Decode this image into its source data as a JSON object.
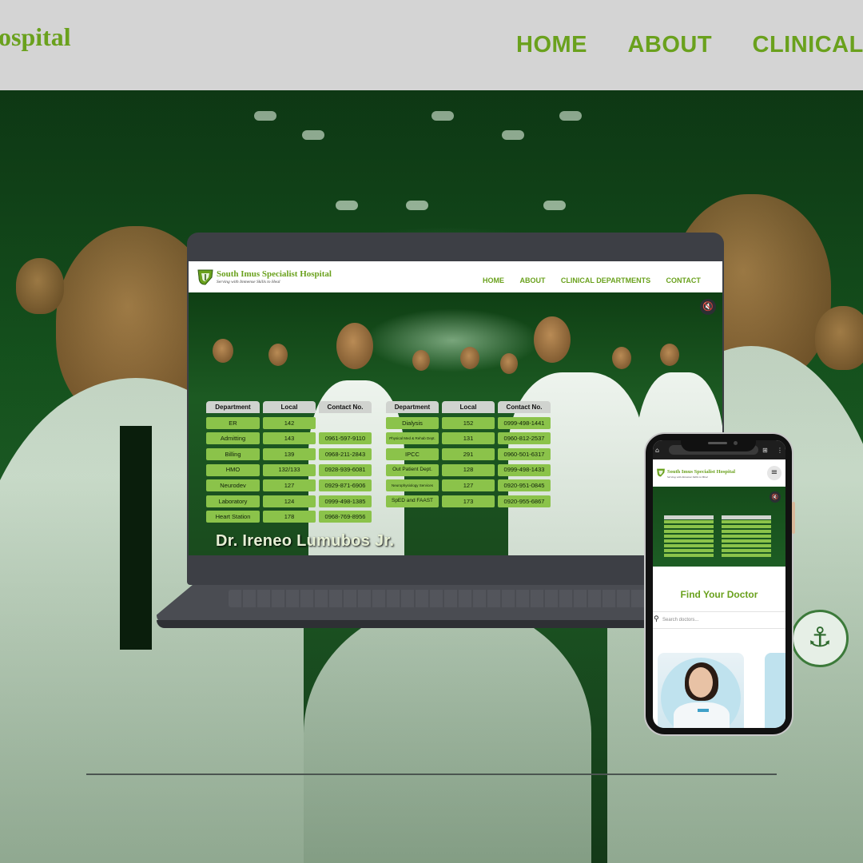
{
  "site": {
    "brand_cropped": "ospital",
    "nav": [
      "HOME",
      "ABOUT",
      "CLINICAL D"
    ],
    "name": "South Imus Specialist Hospital",
    "tagline": "Serving with Immense Skills to Heal",
    "laptop_nav": [
      "HOME",
      "ABOUT",
      "CLINICAL DEPARTMENTS",
      "CONTACT"
    ]
  },
  "hero": {
    "caption": "Dr. Ireneo Lumubos Jr.",
    "mute_icon": "mute-icon"
  },
  "directory": {
    "headers": [
      "Department",
      "Local",
      "Contact No."
    ],
    "left": [
      {
        "dept": "ER",
        "local": "142",
        "contact": ""
      },
      {
        "dept": "Admitting",
        "local": "143",
        "contact": "0961-597-9110"
      },
      {
        "dept": "Billing",
        "local": "139",
        "contact": "0968-211-2843"
      },
      {
        "dept": "HMO",
        "local": "132/133",
        "contact": "0928-939-6081"
      },
      {
        "dept": "Neurodev",
        "local": "127",
        "contact": "0929-871-6906"
      },
      {
        "dept": "Laboratory",
        "local": "124",
        "contact": "0999-498-1385"
      },
      {
        "dept": "Heart Station",
        "local": "178",
        "contact": "0968-769-8956"
      }
    ],
    "right": [
      {
        "dept": "Dialysis",
        "local": "152",
        "contact": "0999-498-1441"
      },
      {
        "dept": "Physical Med & Rehab Dept.",
        "local": "131",
        "contact": "0960-812-2537"
      },
      {
        "dept": "IPCC",
        "local": "291",
        "contact": "0960-501-6317"
      },
      {
        "dept": "Out Patient Dept.",
        "local": "128",
        "contact": "0999-498-1433"
      },
      {
        "dept": "Neurophysiology Services",
        "local": "127",
        "contact": "0920-951-0845"
      },
      {
        "dept": "SpED and FAAST",
        "local": "173",
        "contact": "0920-955-6867"
      }
    ]
  },
  "phone": {
    "section_title": "Find Your Doctor",
    "search_placeholder": "Search doctors..."
  },
  "colors": {
    "brand_green": "#6aa11d",
    "table_green": "#8bc34a",
    "header_gray": "#d4d4d4"
  }
}
